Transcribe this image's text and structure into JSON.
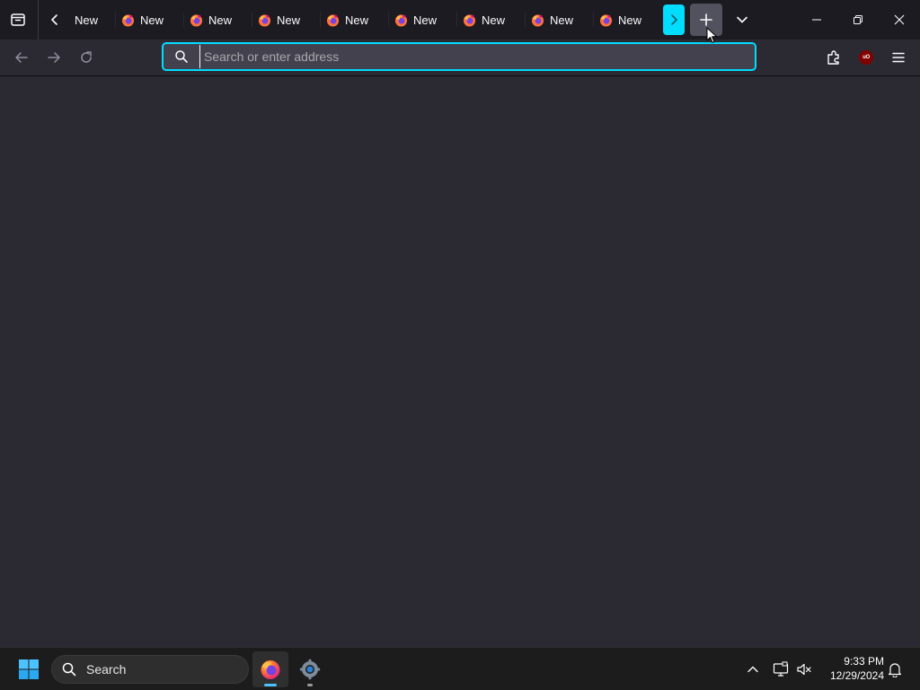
{
  "browser": {
    "tabs": [
      {
        "label": "New",
        "favicon": "firefox-icon"
      },
      {
        "label": "New",
        "favicon": "firefox-icon"
      },
      {
        "label": "New",
        "favicon": "firefox-icon"
      },
      {
        "label": "New",
        "favicon": "firefox-icon"
      },
      {
        "label": "New",
        "favicon": "firefox-icon"
      },
      {
        "label": "New",
        "favicon": "firefox-icon"
      },
      {
        "label": "New",
        "favicon": "firefox-icon"
      },
      {
        "label": "New",
        "favicon": "firefox-icon"
      },
      {
        "label": "New",
        "favicon": "firefox-icon"
      }
    ],
    "urlbar": {
      "placeholder": "Search or enter address",
      "value": ""
    },
    "ublock_badge": "uO",
    "colors": {
      "accent": "#00ddff",
      "toolbar": "#2b2a33",
      "tabstrip": "#1c1b22",
      "urlbar_bg": "#42414d"
    }
  },
  "taskbar": {
    "search_label": "Search",
    "apps": [
      "firefox-icon",
      "settings-icon"
    ],
    "clock": {
      "time": "9:33 PM",
      "date": "12/29/2024"
    }
  }
}
